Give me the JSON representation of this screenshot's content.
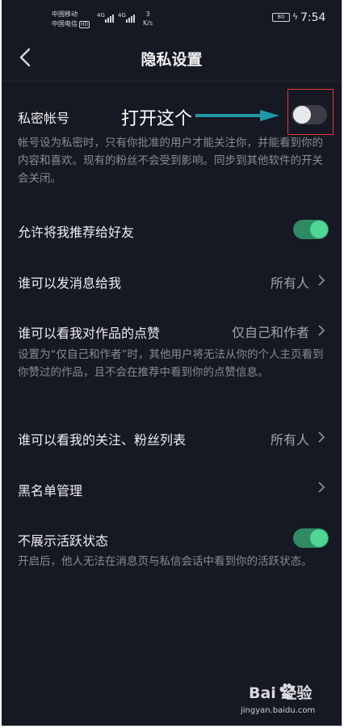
{
  "status_bar": {
    "carrier1": "中国移动",
    "carrier2": "中国电信",
    "hd": "HD",
    "net1": "4G",
    "net2": "4G",
    "speed_value": "3",
    "speed_unit": "K/s",
    "battery": "80",
    "time": "7:54"
  },
  "header": {
    "title": "隐私设置"
  },
  "private_account": {
    "label": "私密帐号",
    "enabled": false,
    "description": "帐号设为私密时，只有你批准的用户才能关注你，并能看到你的内容和喜欢。现有的粉丝不会受到影响。同步到其他软件的开关会关闭。"
  },
  "annotation": {
    "text": "打开这个"
  },
  "recommend": {
    "label": "允许将我推荐给好友",
    "enabled": true
  },
  "message": {
    "label": "谁可以发消息给我",
    "value": "所有人"
  },
  "likes": {
    "label": "谁可以看我对作品的点赞",
    "value": "仅自己和作者",
    "description": "设置为“仅自己和作者”时，其他用户将无法从你的个人主页看到你赞过的作品，且不会在推荐中看到你的点赞信息。"
  },
  "follow_list": {
    "label": "谁可以看我的关注、粉丝列表",
    "value": "所有人"
  },
  "blacklist": {
    "label": "黑名单管理"
  },
  "activity": {
    "label": "不展示活跃状态",
    "enabled": true,
    "description": "开启后，他人无法在消息页与私信会话中看到你的活跃状态。"
  },
  "watermark": {
    "brand": "Bai  经验",
    "sub": "jingyan.baidu.com"
  },
  "colors": {
    "background": "#161823",
    "toggle_on": "#4fd596",
    "highlight": "#e53935",
    "arrow": "#1f9aa6"
  }
}
